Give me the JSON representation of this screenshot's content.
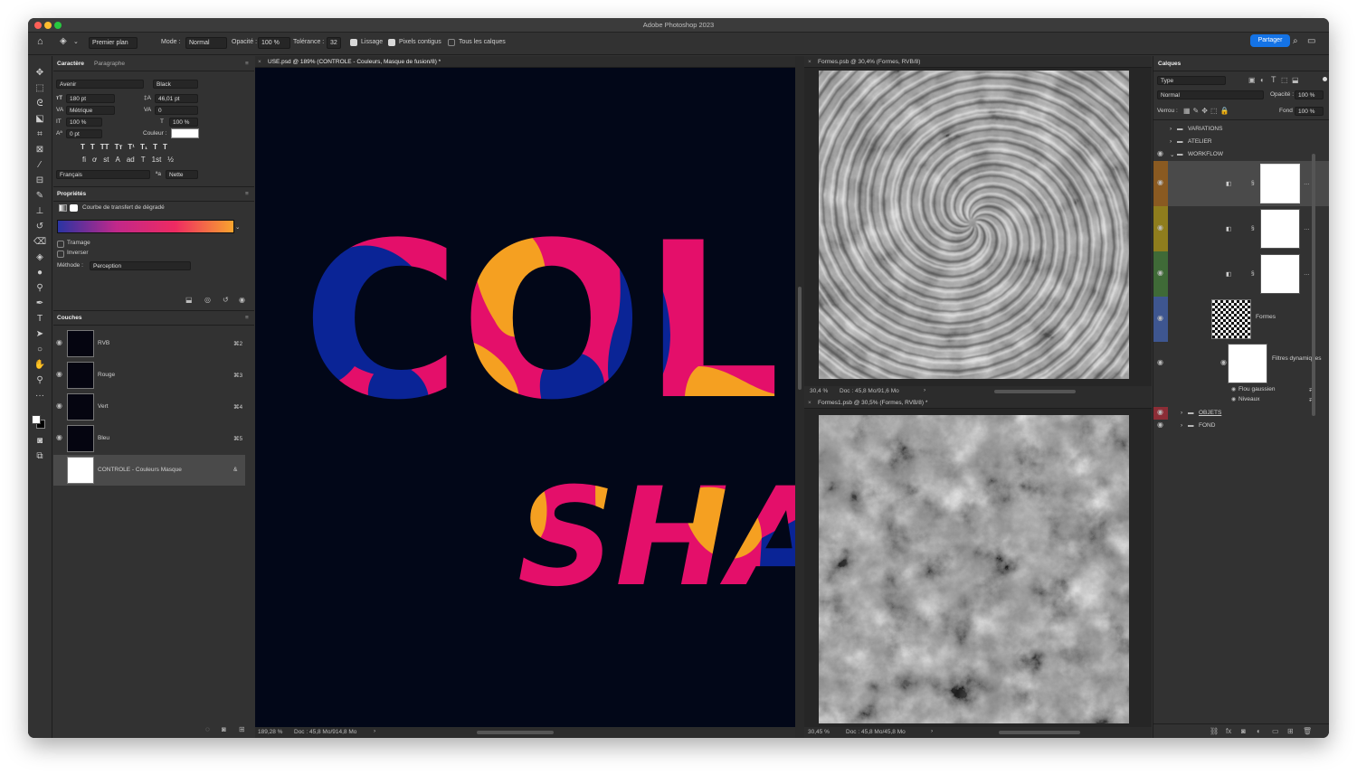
{
  "app": {
    "title": "Adobe Photoshop 2023"
  },
  "options_bar": {
    "preset": "Premier plan",
    "mode_label": "Mode :",
    "mode_value": "Normal",
    "opacity_label": "Opacité :",
    "opacity_value": "100 %",
    "tolerance_label": "Tolérance :",
    "tolerance_value": "32",
    "smoothing_label": "Lissage",
    "smoothing_checked": true,
    "contiguous_label": "Pixels contigus",
    "contiguous_checked": true,
    "all_layers_label": "Tous les calques",
    "all_layers_checked": false,
    "share_label": "Partager"
  },
  "character": {
    "tabs": [
      "Caractère",
      "Paragraphe"
    ],
    "font_family": "Avenir",
    "font_style": "Black",
    "font_size": "180 pt",
    "leading": "46,01 pt",
    "kerning": "Métrique",
    "tracking": "0",
    "vscale": "100 %",
    "hscale": "100 %",
    "baseline": "0 pt",
    "color_label": "Couleur :",
    "type_buttons": [
      "T",
      "T",
      "TT",
      "Tт",
      "T¹",
      "T₁",
      "T",
      "T"
    ],
    "opentype_buttons": [
      "fi",
      "ơ",
      "st",
      "A",
      "ad",
      "T",
      "1st",
      "½"
    ],
    "language": "Français",
    "antialias_label": "ªa",
    "antialias": "Nette"
  },
  "properties": {
    "title": "Propriétés",
    "subtitle": "Courbe de transfert de dégradé",
    "gradient_colors": [
      "#2a34a3",
      "#c1288a",
      "#ee2a62",
      "#f8a42e"
    ],
    "dither_label": "Tramage",
    "reverse_label": "Inverser",
    "method_label": "Méthode :",
    "method_value": "Perception"
  },
  "channels": {
    "title": "Couches",
    "rows": [
      {
        "name": "RVB",
        "shortcut": "⌘2"
      },
      {
        "name": "Rouge",
        "shortcut": "⌘3"
      },
      {
        "name": "Vert",
        "shortcut": "⌘4"
      },
      {
        "name": "Bleu",
        "shortcut": "⌘5"
      },
      {
        "name": "CONTROLE - Couleurs Masque",
        "shortcut": "&"
      }
    ]
  },
  "documents": {
    "main": {
      "tab": "USE.psd @ 189% (CONTROLE - Couleurs, Masque de fusion/8) *",
      "zoom": "189,28 %",
      "doc_info": "Doc : 45,8 Mo/914,8 Mo",
      "canvas_bg": "#020718",
      "text_line1": "COL",
      "text_line2": "SHA",
      "colors": {
        "pink": "#e40f6a",
        "blue": "#0a2496",
        "orange": "#f5a021"
      }
    },
    "swirl": {
      "tab": "Formes.psb @ 30,4% (Formes, RVB/8)",
      "zoom": "30,4 %",
      "doc_info": "Doc : 45,8 Mo/91,6 Mo"
    },
    "clouds": {
      "tab": "Formes1.psb @ 30,5% (Formes, RVB/8) *",
      "zoom": "30,45 %",
      "doc_info": "Doc : 45,8 Mo/45,8 Mo"
    }
  },
  "layers": {
    "title": "Calques",
    "filter_kind": "Type",
    "blend_mode": "Normal",
    "opacity_label": "Opacité :",
    "opacity": "100 %",
    "lock_label": "Verrou :",
    "fill_label": "Fond :",
    "fill": "100 %",
    "items": [
      {
        "name": "VARIATIONS",
        "type": "group"
      },
      {
        "name": "ATELIER",
        "type": "group"
      },
      {
        "name": "WORKFLOW",
        "type": "group"
      },
      {
        "name": "",
        "type": "adjustment",
        "icon": "gradient-map-icon",
        "color": "#8a5a21"
      },
      {
        "name": "",
        "type": "adjustment",
        "icon": "curves-icon",
        "color": "#8f7d1d"
      },
      {
        "name": "",
        "type": "adjustment",
        "icon": "levels-icon",
        "color": "#3f6a37"
      },
      {
        "name": "Formes",
        "type": "smart-object",
        "color": "#3e5690"
      },
      {
        "name": "Filtres dynamiques",
        "type": "smart-filters"
      },
      {
        "name": "Flou gaussien",
        "type": "filter"
      },
      {
        "name": "Niveaux",
        "type": "filter"
      },
      {
        "name": "OBJETS",
        "type": "group",
        "color": "#8c2d36"
      },
      {
        "name": "FOND",
        "type": "group"
      }
    ]
  }
}
